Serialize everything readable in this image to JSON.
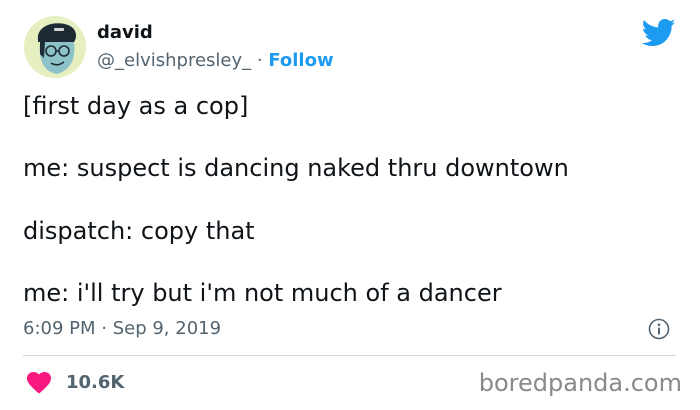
{
  "tweet": {
    "author_name": "david",
    "author_handle": "@_elvishpresley_",
    "separator": "·",
    "follow_label": "Follow",
    "lines": [
      "[first day as a cop]",
      "me: suspect is dancing naked thru downtown",
      "dispatch: copy that",
      "me: i'll try but i'm not much of a dancer"
    ],
    "timestamp": "6:09 PM · Sep 9, 2019",
    "likes": "10.6K"
  },
  "watermark": "boredpanda.com",
  "colors": {
    "accent": "#1d9bf0",
    "heart": "#f91880",
    "secondary_text": "#536471"
  },
  "icons": {
    "avatar": "avatar-cartoon-icon",
    "platform": "twitter-bird-icon",
    "info": "info-icon",
    "like": "heart-icon"
  }
}
